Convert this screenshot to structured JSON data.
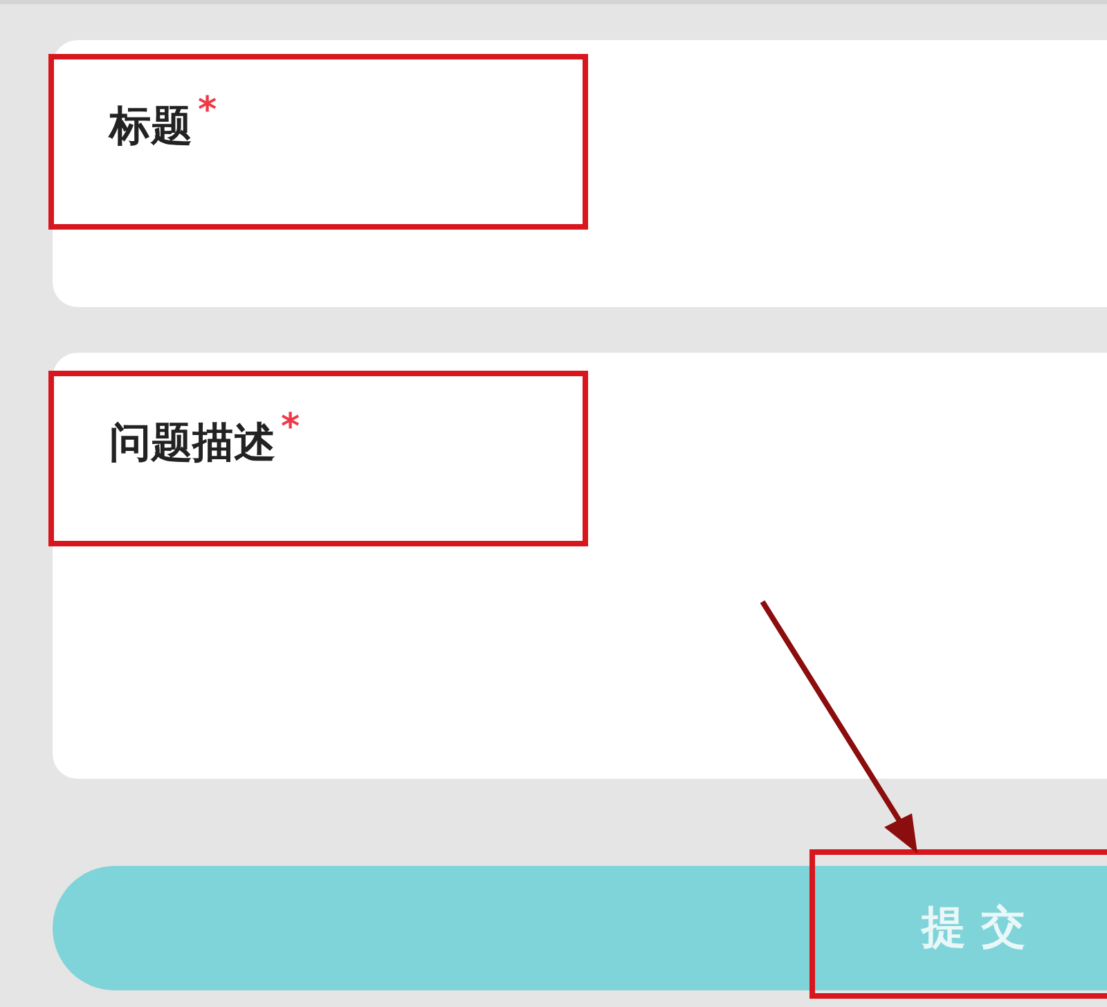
{
  "fields": [
    {
      "label": "标题",
      "required_mark": "*",
      "kind": "single",
      "highlighted": true
    },
    {
      "label": "问题描述",
      "required_mark": "*",
      "kind": "multi",
      "highlighted": true
    }
  ],
  "submit_button": {
    "label": "提 交",
    "highlighted": true,
    "pointer_arrow": true
  }
}
